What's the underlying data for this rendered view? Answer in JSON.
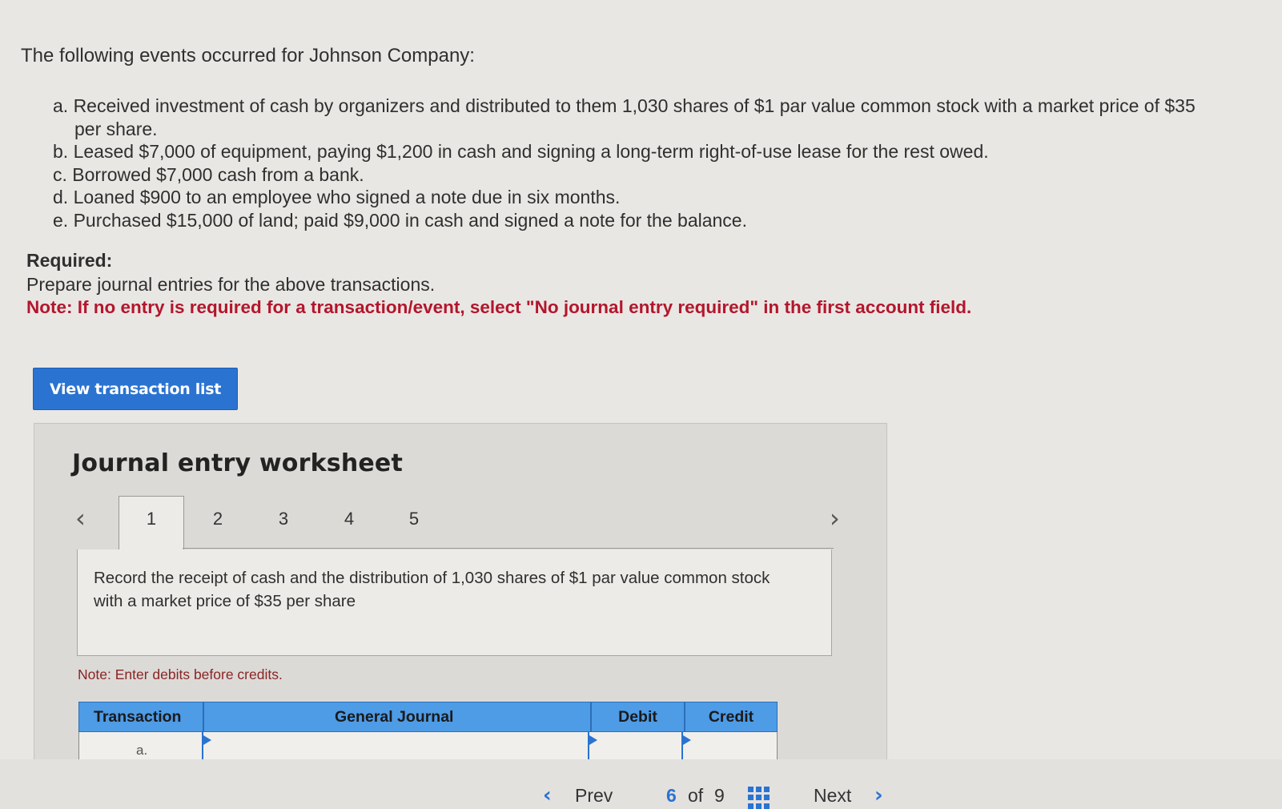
{
  "intro": "The following events occurred for Johnson Company:",
  "events": [
    "a. Received investment of cash by organizers and distributed to them 1,030 shares of $1 par value common stock with a market price of $35 per share.",
    "b. Leased $7,000 of equipment, paying $1,200 in cash and signing a long-term right-of-use lease for the rest owed.",
    "c. Borrowed $7,000 cash from a bank.",
    "d. Loaned $900 to an employee who signed a note due in six months.",
    "e. Purchased $15,000 of land; paid $9,000 in cash and signed a note for the balance."
  ],
  "required": {
    "heading": "Required:",
    "text": "Prepare journal entries for the above transactions.",
    "note": "Note: If no entry is required for a transaction/event, select \"No journal entry required\" in the first account field."
  },
  "buttons": {
    "view_transaction_list": "View transaction list"
  },
  "worksheet": {
    "title": "Journal entry worksheet",
    "tabs": [
      "1",
      "2",
      "3",
      "4",
      "5"
    ],
    "active_tab": "1",
    "description": "Record the receipt of cash and the distribution of 1,030 shares of $1 par value common stock with a market price of $35 per share",
    "note": "Note: Enter debits before credits.",
    "table": {
      "headers": {
        "transaction": "Transaction",
        "general_journal": "General Journal",
        "debit": "Debit",
        "credit": "Credit"
      },
      "rows": [
        {
          "transaction": "a."
        }
      ]
    }
  },
  "pagination": {
    "prev": "Prev",
    "current": "6",
    "of": "of",
    "total": "9",
    "next": "Next"
  },
  "icons": {
    "left": "chevron-left-icon",
    "right": "chevron-right-icon",
    "grid": "grid-icon"
  },
  "colors": {
    "accent": "#2a73d1",
    "note_red": "#b3162c",
    "table_header": "#4e9be6"
  }
}
